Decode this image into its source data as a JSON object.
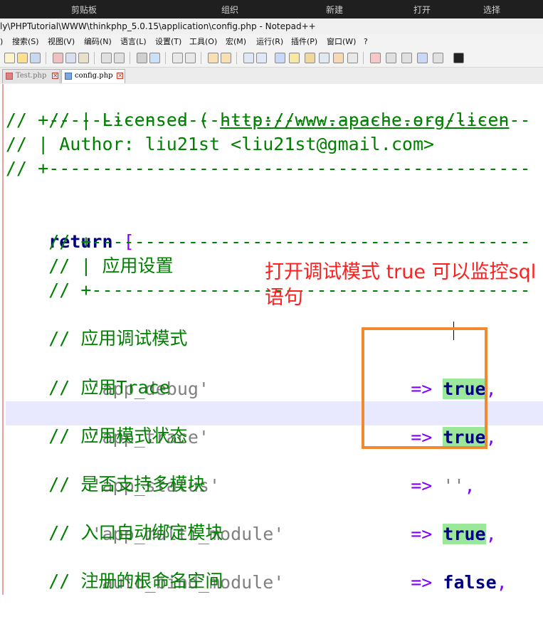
{
  "ribbon": {
    "items": [
      "剪贴板",
      "组织",
      "新建",
      "打开",
      "选择"
    ]
  },
  "window": {
    "title": "ly\\PHPTutorial\\WWW\\thinkphp_5.0.15\\application\\config.php - Notepad++"
  },
  "menu": {
    "items": [
      ")",
      "搜索(S)",
      "视图(V)",
      "编码(N)",
      "语言(L)",
      "设置(T)",
      "工具(O)",
      "宏(M)",
      "运行(R)",
      "插件(P)",
      "窗口(W)",
      "?"
    ]
  },
  "tabs": [
    {
      "label": "Test.php",
      "active": false
    },
    {
      "label": "config.php",
      "active": true
    }
  ],
  "code": {
    "l1_a": "// | Licensed ( ",
    "l1_link": "http://www.apache.org/licen",
    "l2": "// +---------------------------------------------",
    "l3": "// | Author: liu21st <liu21st@gmail.com>",
    "l4": "// +---------------------------------------------",
    "l5_kw": "return",
    "l5_br": " [",
    "l6": "    // +-----------------------------------------",
    "l7": "    // | 应用设置",
    "l8": "    // +-----------------------------------------",
    "l9": "    // 应用调试模式",
    "l10_key": "    'app_debug'",
    "l10_op": "=>",
    "l10_val": "true",
    "l10_end": ",",
    "l11": "    // 应用Trace",
    "l12_key": "    'app_trace'",
    "l12_op": "=>",
    "l12_val": "true",
    "l12_end": ",",
    "l13": "    // 应用模式状态",
    "l14_key": "    'app_status'",
    "l14_op": "=>",
    "l14_val": "''",
    "l14_end": ",",
    "l15": "    // 是否支持多模块",
    "l16_key": "    'app_multi_module'",
    "l16_op": "=>",
    "l16_val": "true",
    "l16_end": ",",
    "l17": "    // 入口自动绑定模块",
    "l18_key": "    'auto_bind_module'",
    "l18_op": "=>",
    "l18_val": "false",
    "l18_end": ",",
    "l19": "    // 注册的根命名空间"
  },
  "annotation": {
    "text": "打开调试模式 true 可以监控sql语句"
  },
  "colors": {
    "comment": "#008000",
    "string": "#808080",
    "keyword": "#000080",
    "operator": "#8000ff",
    "annotation": "#ff2020",
    "box": "#f08a30",
    "highlight": "#9be89b"
  }
}
